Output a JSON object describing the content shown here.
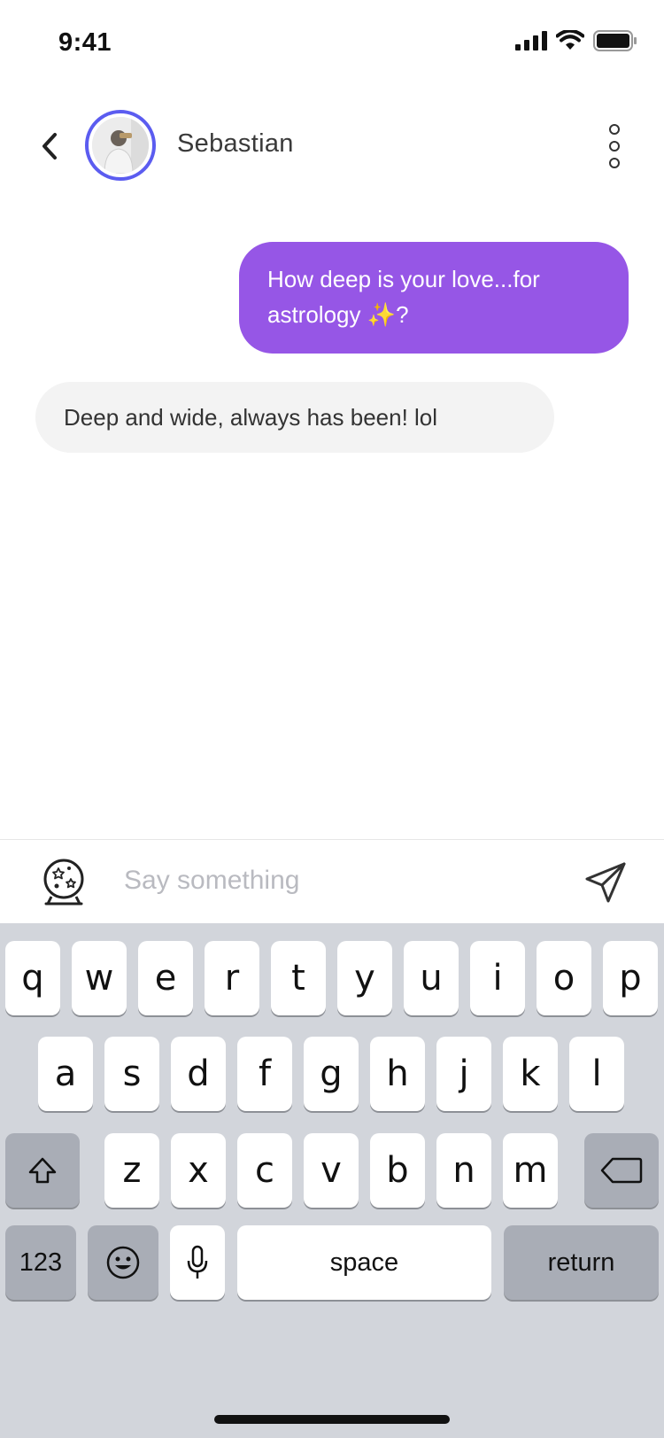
{
  "status_bar": {
    "time": "9:41"
  },
  "header": {
    "contact_name": "Sebastian"
  },
  "messages": [
    {
      "direction": "outgoing",
      "text": "How deep is your love...for astrology ✨?"
    },
    {
      "direction": "incoming",
      "text": "Deep and wide, always has been! lol"
    }
  ],
  "composer": {
    "placeholder": "Say something",
    "value": ""
  },
  "keyboard": {
    "row1": [
      "q",
      "w",
      "e",
      "r",
      "t",
      "y",
      "u",
      "i",
      "o",
      "p"
    ],
    "row2": [
      "a",
      "s",
      "d",
      "f",
      "g",
      "h",
      "j",
      "k",
      "l"
    ],
    "row3": [
      "z",
      "x",
      "c",
      "v",
      "b",
      "n",
      "m"
    ],
    "numbers_label": "123",
    "space_label": "space",
    "return_label": "return"
  },
  "colors": {
    "accent": "#9656e6",
    "avatar_ring": "#5b5cf0",
    "incoming_bubble": "#f3f3f3",
    "keyboard_bg": "#d2d5db"
  },
  "icons": [
    "cellular-signal-icon",
    "wifi-icon",
    "battery-icon",
    "back-chevron-icon",
    "more-vertical-icon",
    "crystal-ball-icon",
    "send-icon",
    "shift-icon",
    "delete-icon",
    "emoji-icon",
    "microphone-icon"
  ]
}
